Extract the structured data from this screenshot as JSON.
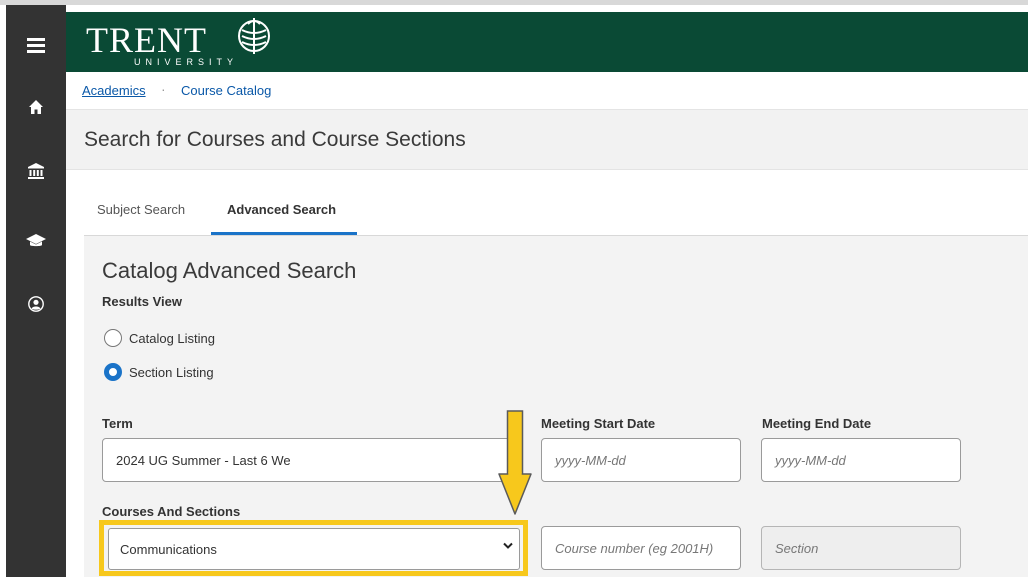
{
  "header": {
    "logo_word": "TRENT",
    "logo_sub": "UNIVERSITY"
  },
  "sidebar": {
    "items": [
      {
        "icon": "hamburger-menu-icon"
      },
      {
        "icon": "home-icon"
      },
      {
        "icon": "institution-icon"
      },
      {
        "icon": "graduation-cap-icon"
      },
      {
        "icon": "user-circle-icon"
      }
    ]
  },
  "breadcrumb": {
    "first": "Academics",
    "separator": "·",
    "second": "Course Catalog"
  },
  "page": {
    "title": "Search for Courses and Course Sections"
  },
  "tabs": [
    {
      "label": "Subject Search",
      "active": false
    },
    {
      "label": "Advanced Search",
      "active": true
    }
  ],
  "form": {
    "heading": "Catalog Advanced Search",
    "results_view_label": "Results View",
    "options": [
      {
        "label": "Catalog Listing",
        "checked": false
      },
      {
        "label": "Section Listing",
        "checked": true
      }
    ],
    "term_label": "Term",
    "term_value": "2024 UG Summer - Last 6 We",
    "meeting_start_label": "Meeting Start Date",
    "meeting_start_placeholder": "yyyy-MM-dd",
    "meeting_end_label": "Meeting End Date",
    "meeting_end_placeholder": "yyyy-MM-dd",
    "courses_label": "Courses And Sections",
    "subject_value": "Communications",
    "course_number_placeholder": "Course number (eg 2001H)",
    "section_placeholder": "Section"
  },
  "colors": {
    "header_green": "#0a4a35",
    "sidebar_dark": "#333333",
    "accent_blue": "#1a73c8",
    "highlight_yellow": "#f7c81c"
  }
}
